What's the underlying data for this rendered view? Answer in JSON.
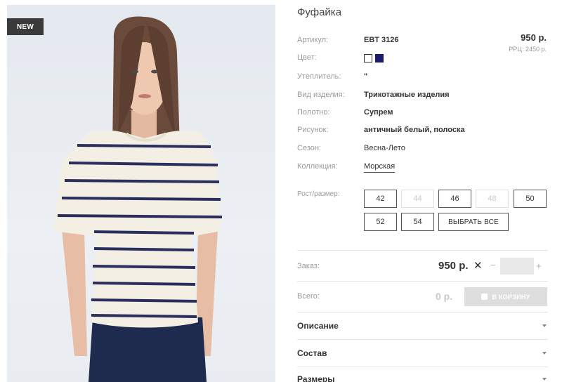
{
  "badge": "NEW",
  "product": {
    "title": "Фуфайка",
    "price": "950 р.",
    "rrp": "РРЦ: 2450 р."
  },
  "specs": [
    {
      "label": "Артикул:",
      "value": "EBT 3126"
    },
    {
      "label": "Цвет:",
      "value": ""
    },
    {
      "label": "Утеплитель:",
      "value": "\""
    },
    {
      "label": "Вид изделия:",
      "value": "Трикотажные изделия"
    },
    {
      "label": "Полотно:",
      "value": "Супрем"
    },
    {
      "label": "Рисунок:",
      "value": "античный белый, полоска"
    },
    {
      "label": "Сезон:",
      "value": "Весна-Лето"
    },
    {
      "label": "Коллекция:",
      "value": "Морская"
    }
  ],
  "colors": [
    {
      "name": "белый",
      "hex": "#ffffff"
    },
    {
      "name": "синий",
      "hex": "#1a1c6e"
    }
  ],
  "sizes": {
    "label": "Рост/размер:",
    "items": [
      {
        "value": "42",
        "available": true
      },
      {
        "value": "44",
        "available": false
      },
      {
        "value": "46",
        "available": true
      },
      {
        "value": "48",
        "available": false
      },
      {
        "value": "50",
        "available": true
      },
      {
        "value": "52",
        "available": true
      },
      {
        "value": "54",
        "available": true
      }
    ],
    "select_all": "ВЫБРАТЬ ВСЕ"
  },
  "order": {
    "label": "Заказ:",
    "price": "950 р.",
    "times": "✕",
    "minus": "−",
    "plus": "+",
    "quantity": ""
  },
  "total": {
    "label": "Всего:",
    "value": "0 р.",
    "cart_button": "В КОРЗИНУ"
  },
  "accordion": [
    {
      "title": "Описание"
    },
    {
      "title": "Состав"
    },
    {
      "title": "Размеры"
    }
  ],
  "theme": {
    "stripe": "#2b2f5e",
    "shirt": "#f3efe4",
    "pants": "#1f2a4f"
  }
}
